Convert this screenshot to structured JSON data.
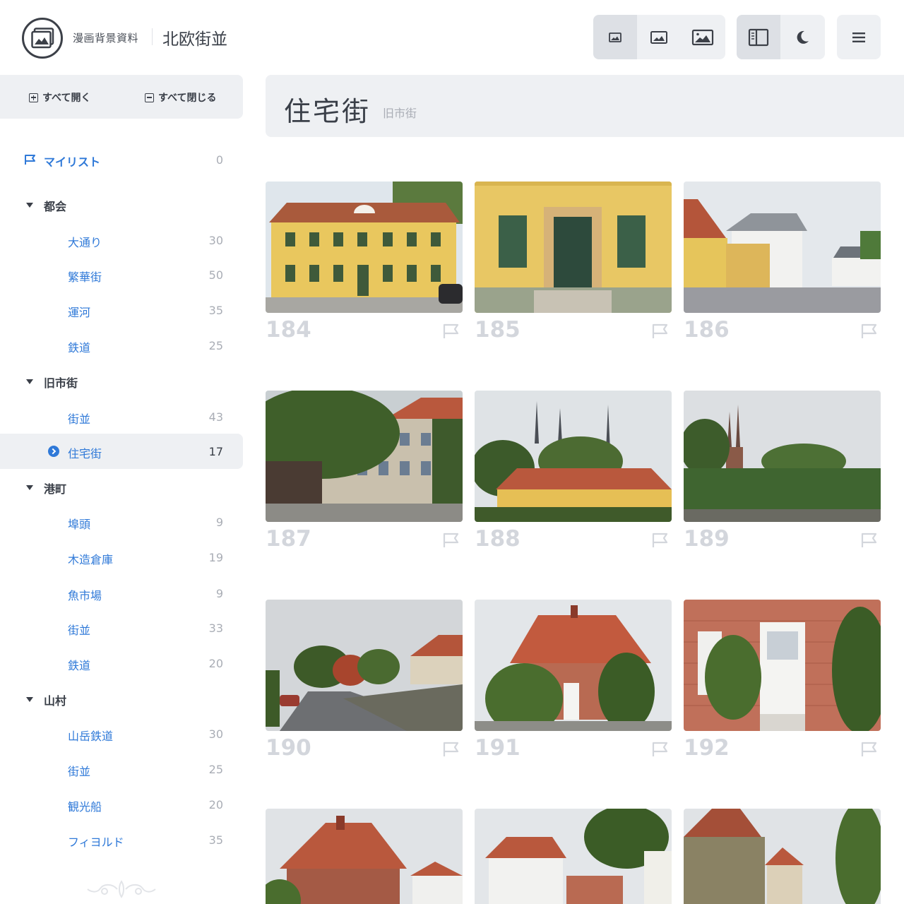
{
  "header": {
    "app_title": "漫画背景資料",
    "collection_title": "北欧街並",
    "toolbar": {
      "size_small": "image-small-icon",
      "size_medium": "image-medium-icon",
      "size_large": "image-large-icon",
      "sidebar_toggle": "sidebar-toggle-icon",
      "dark_mode": "moon-icon",
      "menu": "hamburger-menu-icon"
    }
  },
  "sidebar": {
    "expand_all": "すべて開く",
    "collapse_all": "すべて閉じる",
    "mylist": {
      "label": "マイリスト",
      "count": "0"
    },
    "categories": [
      {
        "label": "都会",
        "items": [
          {
            "label": "大通り",
            "count": "30"
          },
          {
            "label": "繁華街",
            "count": "50"
          },
          {
            "label": "運河",
            "count": "35"
          },
          {
            "label": "鉄道",
            "count": "25"
          }
        ]
      },
      {
        "label": "旧市街",
        "items": [
          {
            "label": "街並",
            "count": "43"
          },
          {
            "label": "住宅街",
            "count": "17",
            "selected": true
          }
        ]
      },
      {
        "label": "港町",
        "items": [
          {
            "label": "埠頭",
            "count": "9"
          },
          {
            "label": "木造倉庫",
            "count": "19"
          },
          {
            "label": "魚市場",
            "count": "9"
          },
          {
            "label": "街並",
            "count": "33"
          },
          {
            "label": "鉄道",
            "count": "20"
          }
        ]
      },
      {
        "label": "山村",
        "items": [
          {
            "label": "山岳鉄道",
            "count": "30"
          },
          {
            "label": "街並",
            "count": "25"
          },
          {
            "label": "観光船",
            "count": "20"
          },
          {
            "label": "フィヨルド",
            "count": "35"
          }
        ]
      }
    ]
  },
  "main": {
    "title": "住宅街",
    "subtitle": "旧市街",
    "photos": [
      {
        "number": "184"
      },
      {
        "number": "185"
      },
      {
        "number": "186"
      },
      {
        "number": "187"
      },
      {
        "number": "188"
      },
      {
        "number": "189"
      },
      {
        "number": "190"
      },
      {
        "number": "191"
      },
      {
        "number": "192"
      },
      {
        "number": ""
      },
      {
        "number": ""
      },
      {
        "number": ""
      }
    ]
  },
  "colors": {
    "accent": "#2f79d8",
    "panel": "#eef0f3",
    "muted": "#a9adb5"
  }
}
